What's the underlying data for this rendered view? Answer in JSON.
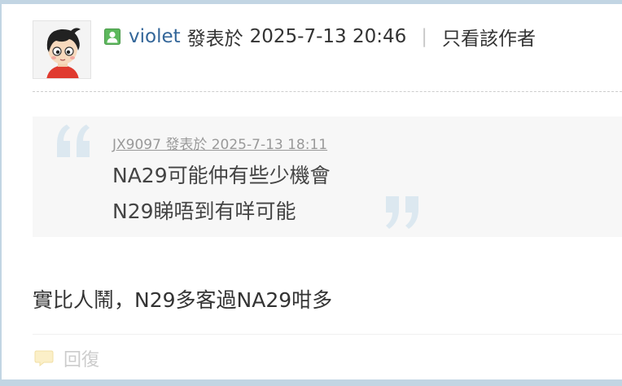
{
  "post": {
    "author": "violet",
    "posted_label": "發表於",
    "posted_time": "2025-7-13 20:46",
    "separator": "|",
    "only_author_label": "只看該作者"
  },
  "quote": {
    "meta": "JX9097 發表於 2025-7-13 18:11",
    "lines": [
      "NA29可能仲有些少機會",
      "N29睇唔到有咩可能"
    ]
  },
  "body": {
    "text": "實比人鬧，N29多客過NA29咁多"
  },
  "actions": {
    "reply_label": "回復"
  },
  "icons": {
    "online": "user-online-icon",
    "quote_open": "open-quote-icon",
    "quote_close": "close-quote-icon",
    "reply": "speech-bubble-icon"
  },
  "colors": {
    "border": "#c2d5e3",
    "author_link": "#336699",
    "online_green": "#5cb85c",
    "quote_bg": "#f7f7f7",
    "quote_mark": "#dce8f0"
  }
}
